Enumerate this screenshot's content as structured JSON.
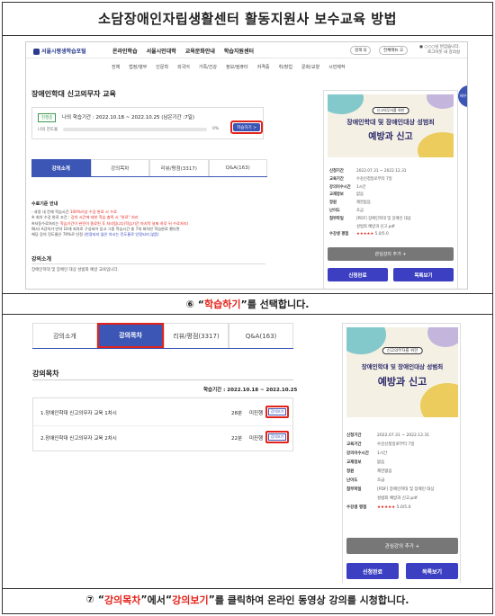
{
  "doc_title": "소담장애인자립생활센터 활동지원사 보수교육 방법",
  "step6": {
    "num": "⑥",
    "q_open": "“",
    "highlight": "학습하기",
    "q_close": "”",
    "rest": "를 선택합니다."
  },
  "step7": {
    "num": "⑦",
    "q1_open": "“",
    "h1": "강의목차",
    "q1_close": "”",
    "mid": "에서 ",
    "q2_open": "“",
    "h2": "강의보기",
    "q2_close": "”",
    "rest": "를 클릭하여 온라인 동영상 강의를 시청합니다."
  },
  "portal": {
    "logo": "서울시평생학습포털",
    "nav": [
      "온라인학습",
      "서울시민대학",
      "교육문화안내",
      "학습지원센터"
    ],
    "search_btn": "검색 Q",
    "all_menu_btn": "전체메뉴 ☰",
    "user_line1": "● ○○○님 반갑습니다.",
    "user_line2": "로그아웃   내 강의실",
    "subnav": [
      "전체",
      "법정/행무",
      "인문학",
      "외국어",
      "가족/건강",
      "정보/컴퓨터",
      "자격증",
      "취/창업",
      "문화/교양",
      "시민제작"
    ],
    "side_bubble": "배우고 싶은"
  },
  "course": {
    "title": "장애인학대 신고의무자 교육",
    "badge": "진행중",
    "period_label": "나의 학습기간 : 2022.10.18 ~ 2022.10.25 (남은기간 :7일)",
    "progress_label": "나의 진도율",
    "progress_pct": "0%",
    "progress_value": 0,
    "learn_btn": "학습하기 >"
  },
  "tabs": [
    "강의소개",
    "강의목차",
    "리뷰/평점(3317)",
    "Q&A(163)"
  ],
  "notice": {
    "title": "수료기준 안내",
    "lines": [
      {
        "t": "- 과정 내 전체 학습시간 ",
        "r": "100%이상 수강 완료 시 수료",
        "b": ""
      },
      {
        "t": "※ 회차 수강 완료 조건 : ",
        "r": "강의 시간에 대한 학습 충족 시 \"완료\" 처리",
        "b": ""
      },
      {
        "t": "※자동수료처리는 ",
        "r": "학습기간이 완전히 종료된 후 처리됩니다(학습기간 마지막 날짜 하루 뒤 수료처리)",
        "b": ""
      },
      {
        "t": "예시) A강의가 만약 10개 회차로 구성되어 있고 그중 학습시간 총 7개 회차만 학습완료 했다면",
        "r": "",
        "b": ""
      },
      {
        "t": "해당 강의 진도율은 70%로 인정 ",
        "r": "",
        "b": "(한광되지 않은 차시는 진도율로 인정되지 않음)"
      }
    ]
  },
  "intro": {
    "title": "강의소개",
    "text": "장애인학대 및 장애인 대상 성범죄 예방 교육입니다."
  },
  "toc": {
    "title": "강의목차",
    "period": "학습기간 : 2022.10.18 ~ 2022.10.25",
    "rows": [
      {
        "name": "1.장애인학대 신고의무자 교육 1차시",
        "dur": "28분",
        "status": "미진행",
        "btn": "강의보기"
      },
      {
        "name": "2.장애인학대 신고의무자 교육 2차시",
        "dur": "22분",
        "status": "미진행",
        "btn": "강의보기"
      }
    ]
  },
  "card": {
    "pill": "신고의무자를 위한",
    "line1": "장애인학대 및 장애인대상 성범죄",
    "line2": "예방과 신고",
    "info": [
      {
        "k": "신청기간",
        "v": "2022.07.31 ~ 2022.12.31"
      },
      {
        "k": "교육기간",
        "v": "수강신청일로부터 7일"
      },
      {
        "k": "강의이수시간",
        "v": "1시간"
      },
      {
        "k": "교재정보",
        "v": "없음"
      },
      {
        "k": "정원",
        "v": "제한없음"
      },
      {
        "k": "난이도",
        "v": "초급"
      },
      {
        "k": "첨부파일",
        "v": "[PDF] 장애인학대 및 장애인 대상"
      },
      {
        "k": "",
        "v": "성범죄 예방과 신고.pdf"
      }
    ],
    "rating_label": "수강생 평점",
    "stars": "★★★★★",
    "rating": "5.0/5.0",
    "rating_value": 5.0,
    "wish_btn": "관심강의 추가 +",
    "apply_btn": "신청완료",
    "list_btn": "목록보기"
  },
  "colors": {
    "accent": "#3c56b5",
    "highlight": "#e2231a",
    "button": "#3c3fc1"
  }
}
